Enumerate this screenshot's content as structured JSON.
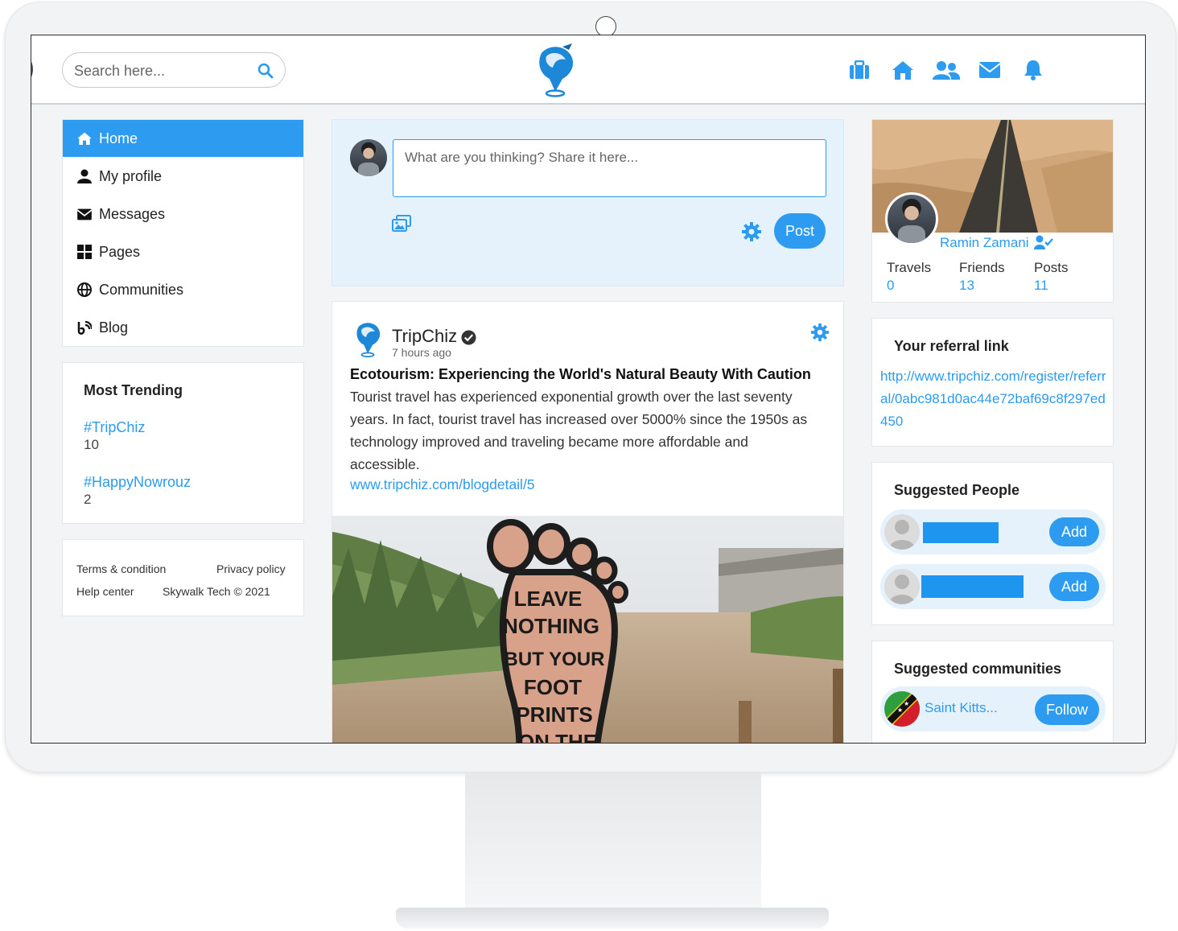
{
  "header": {
    "search_placeholder": "Search here...",
    "nav_icons": [
      "suitcase-icon",
      "home-icon",
      "users-icon",
      "envelope-icon",
      "bell-icon"
    ]
  },
  "colors": {
    "accent": "#2c9bf0",
    "light_accent": "#e5f2fc"
  },
  "sidebar": {
    "items": [
      {
        "label": "Home",
        "icon": "home-icon",
        "active": true
      },
      {
        "label": "My profile",
        "icon": "user-icon"
      },
      {
        "label": "Messages",
        "icon": "envelope-icon"
      },
      {
        "label": "Pages",
        "icon": "grid-icon"
      },
      {
        "label": "Communities",
        "icon": "globe-icon"
      },
      {
        "label": "Blog",
        "icon": "blog-icon"
      }
    ]
  },
  "trending": {
    "title": "Most Trending",
    "tags": [
      {
        "tag": "#TripChiz",
        "count": "10"
      },
      {
        "tag": "#HappyNowrouz",
        "count": "2"
      }
    ]
  },
  "footer": {
    "terms": "Terms & condition",
    "privacy": "Privacy policy",
    "help": "Help center",
    "copyright": "Skywalk Tech © 2021"
  },
  "composer": {
    "placeholder": "What are you thinking? Share it here...",
    "post_label": "Post"
  },
  "post": {
    "author": "TripChiz",
    "time": "7 hours ago",
    "title": "Ecotourism: Experiencing the World's Natural Beauty With Caution",
    "body": "Tourist travel has experienced exponential growth over the last seventy years. In fact, tourist travel has increased over 5000% since the 1950s as technology improved and traveling became more affordable and accessible.",
    "link": "www.tripchiz.com/blogdetail/5",
    "image_sign_lines": [
      "LEAVE",
      "NOTHING",
      "BUT YOUR",
      "FOOT",
      "PRINTS",
      "ON THE"
    ]
  },
  "profile": {
    "name": "Ramin Zamani",
    "stats": [
      {
        "label": "Travels",
        "value": "0"
      },
      {
        "label": "Friends",
        "value": "13"
      },
      {
        "label": "Posts",
        "value": "11"
      }
    ]
  },
  "referral": {
    "title": "Your referral link",
    "url": "http://www.tripchiz.com/register/referral/0abc981d0ac44e72baf69c8f297ed450"
  },
  "suggested_people": {
    "title": "Suggested People",
    "add_label": "Add"
  },
  "suggested_communities": {
    "title": "Suggested communities",
    "items": [
      {
        "name": "Saint Kitts...",
        "follow_label": "Follow"
      }
    ]
  }
}
